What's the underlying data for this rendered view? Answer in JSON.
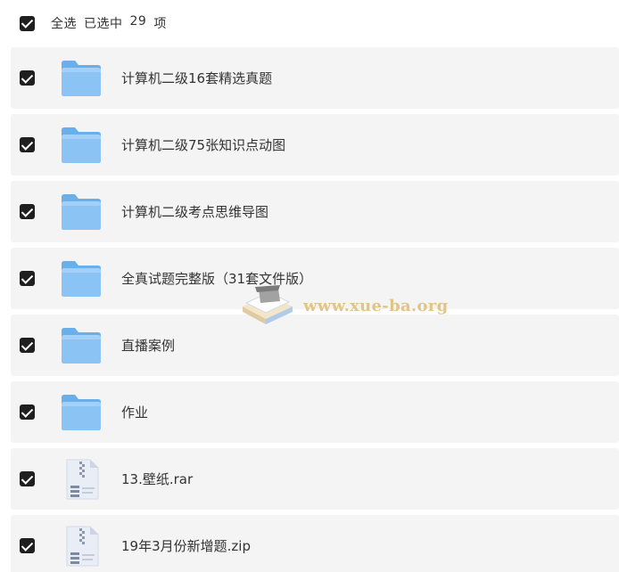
{
  "header": {
    "select_all_label": "全选",
    "selected_label": "已选中",
    "selected_count": "29",
    "count_unit": "项"
  },
  "items": [
    {
      "name": "计算机二级16套精选真题",
      "type": "folder-icon"
    },
    {
      "name": "计算机二级75张知识点动图",
      "type": "folder-icon"
    },
    {
      "name": "计算机二级考点思维导图",
      "type": "folder-icon"
    },
    {
      "name": "全真试题完整版（31套文件版）",
      "type": "folder-icon"
    },
    {
      "name": "直播案例",
      "type": "folder-icon"
    },
    {
      "name": "作业",
      "type": "folder-icon"
    },
    {
      "name": "13.壁纸.rar",
      "type": "archive-file-icon"
    },
    {
      "name": "19年3月份新增题.zip",
      "type": "archive-file-icon"
    }
  ],
  "watermark": {
    "text": "www.xue-ba.org"
  },
  "colors": {
    "checkbox": "#1f1f1f",
    "row_background": "#f4f4f4",
    "folder_front": "#8cc3f5",
    "folder_back": "#6aaeea",
    "watermark": "#e0bf7c"
  }
}
